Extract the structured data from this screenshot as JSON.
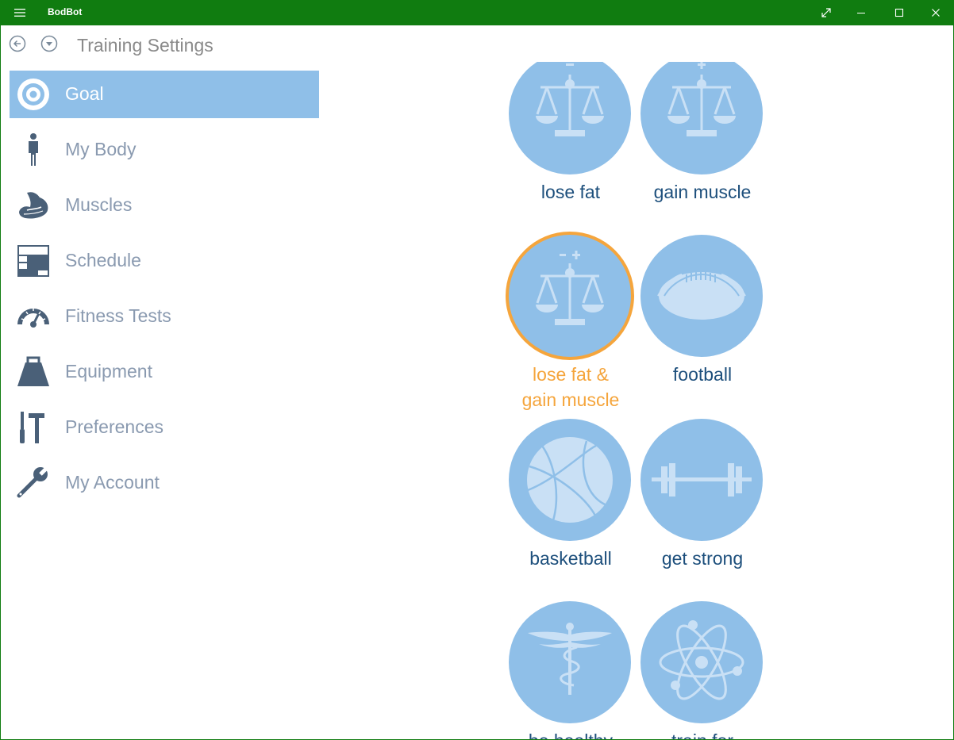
{
  "window": {
    "title": "BodBot"
  },
  "header": {
    "title": "Training Settings"
  },
  "sidebar": {
    "items": [
      {
        "label": "Goal",
        "icon": "target-icon",
        "active": true
      },
      {
        "label": "My Body",
        "icon": "person-icon"
      },
      {
        "label": "Muscles",
        "icon": "flexed-arm-icon"
      },
      {
        "label": "Schedule",
        "icon": "calendar-grid-icon"
      },
      {
        "label": "Fitness Tests",
        "icon": "speedometer-icon"
      },
      {
        "label": "Equipment",
        "icon": "kettle-weight-icon"
      },
      {
        "label": "Preferences",
        "icon": "tools-icon"
      },
      {
        "label": "My Account",
        "icon": "wrench-icon"
      }
    ]
  },
  "goals": [
    {
      "label": "lose fat",
      "icon": "scale-minus-icon"
    },
    {
      "label": "gain muscle",
      "icon": "scale-plus-icon"
    },
    {
      "label_line1": "lose fat &",
      "label_line2": "gain muscle",
      "icon": "scale-minus-plus-icon",
      "selected": true
    },
    {
      "label": "football",
      "icon": "football-icon"
    },
    {
      "label": "basketball",
      "icon": "basketball-icon"
    },
    {
      "label": "get strong",
      "icon": "barbell-icon"
    },
    {
      "label": "be healthy",
      "icon": "caduceus-icon"
    },
    {
      "label": "train for",
      "icon": "atom-icon"
    }
  ],
  "colors": {
    "titlebar": "#107c10",
    "accent": "#8fbfe8",
    "selected": "#f5a53c",
    "label": "#1d4f7c",
    "sidebar_text": "#8a9ab0",
    "sidebar_icon": "#4a6078"
  }
}
